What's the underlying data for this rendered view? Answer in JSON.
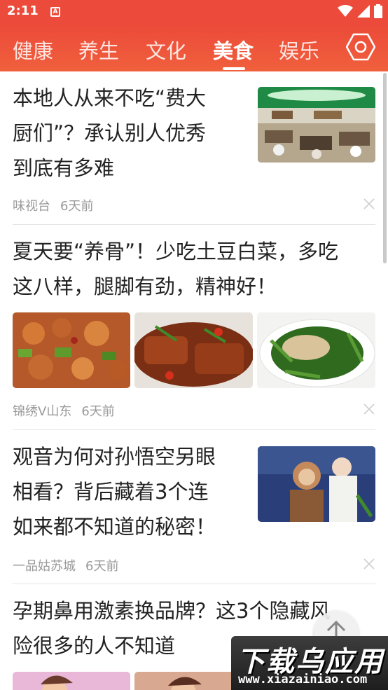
{
  "status_bar": {
    "time": "2:11",
    "notification_letter": "A"
  },
  "tabs": [
    {
      "label": "健康",
      "active": false
    },
    {
      "label": "养生",
      "active": false
    },
    {
      "label": "文化",
      "active": false
    },
    {
      "label": "美食",
      "active": true
    },
    {
      "label": "娱乐",
      "active": false
    }
  ],
  "articles": [
    {
      "title_lines": [
        "本地人从来不吃“费大",
        "厨们”？承认别人优秀",
        "到底有多难"
      ],
      "source": "味视台",
      "time": "6天前",
      "thumbnail": "restaurant-photo"
    },
    {
      "title_lines": [
        "夏天要“养骨”！少吃土豆白菜，多吃",
        "这八样，腿脚有劲，精神好！"
      ],
      "source": "锦绣V山东",
      "time": "6天前",
      "thumbnails": [
        "chicken-dish-photo",
        "braised-fish-photo",
        "spinach-dish-photo"
      ]
    },
    {
      "title_lines": [
        "观音为何对孙悟空另眼",
        "相看？背后藏着3个连",
        "如来都不知道的秘密！"
      ],
      "source": "一品姑苏城",
      "time": "6天前",
      "thumbnail": "journey-west-photo"
    },
    {
      "title_lines": [
        "孕期鼻用激素换品牌？这3个隐藏风",
        "险很多的人不知道"
      ],
      "thumbnails": [
        "pregnant-cartoon-1",
        "pregnant-cartoon-2"
      ]
    }
  ],
  "watermark": {
    "title": "下载乌应用",
    "url": "www.xiazainiao.com"
  },
  "colors": {
    "brand": "#ec4a3a",
    "meta_text": "#9a9a9a"
  }
}
